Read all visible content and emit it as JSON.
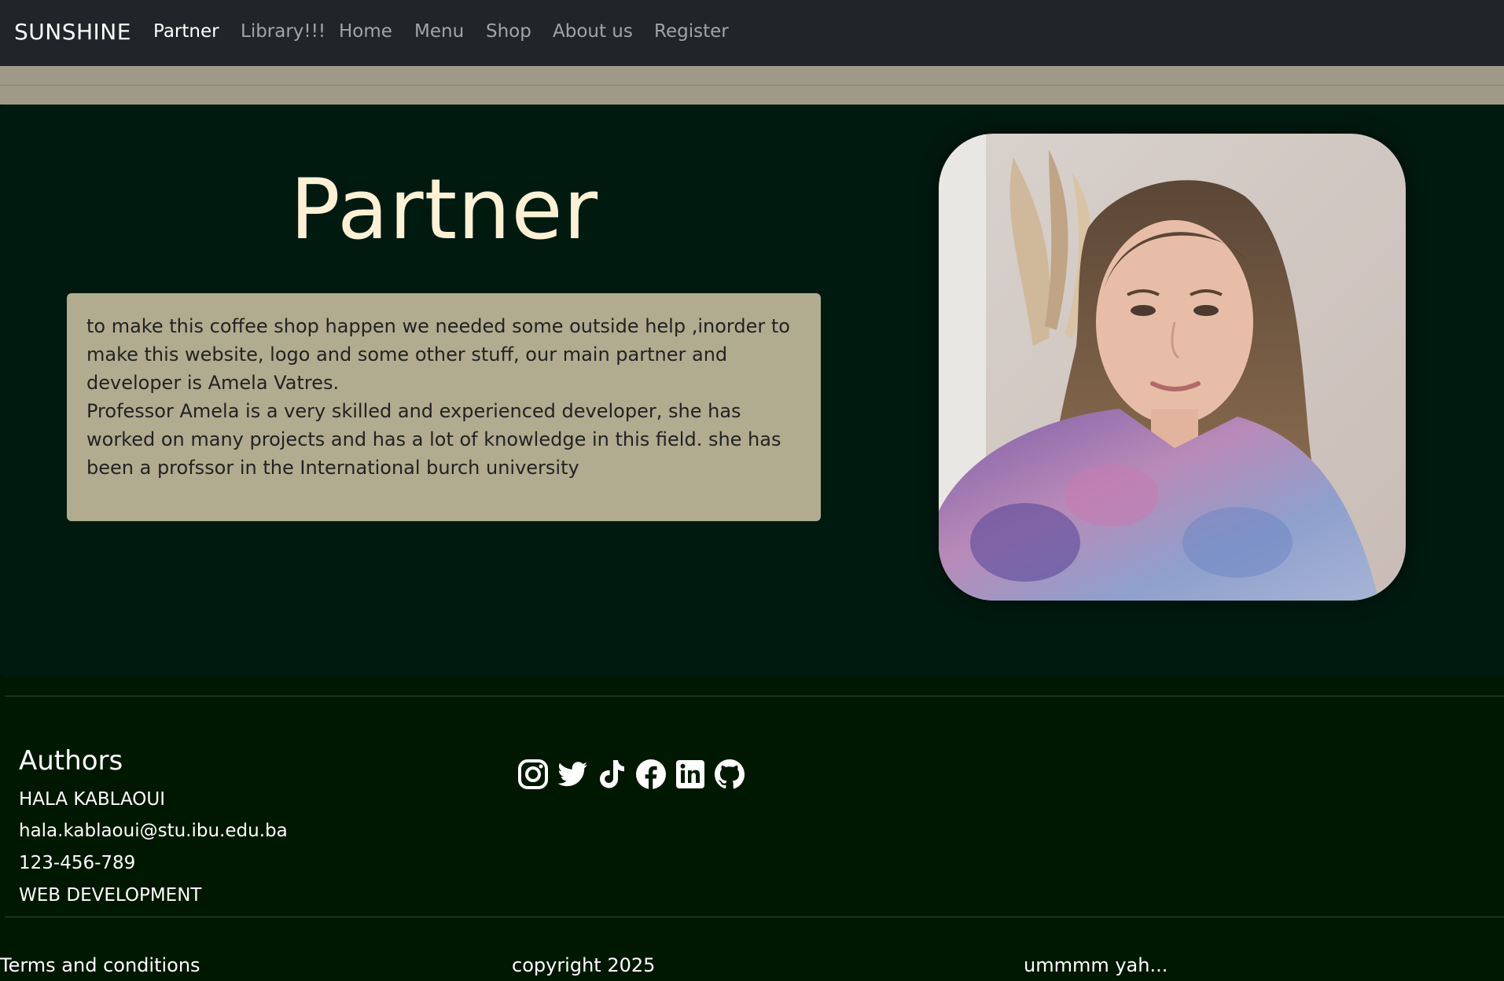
{
  "navbar": {
    "brand": "SUNSHINE",
    "items": [
      {
        "label": "Partner",
        "active": true
      },
      {
        "label": "Library!!!",
        "active": false
      },
      {
        "label": "Home",
        "active": false
      },
      {
        "label": "Menu",
        "active": false
      },
      {
        "label": "Shop",
        "active": false
      },
      {
        "label": "About us",
        "active": false
      },
      {
        "label": "Register",
        "active": false
      }
    ]
  },
  "hero": {
    "title": "Partner",
    "paragraph_1": "to make this coffee shop happen we needed some outside help ,inorder to make this website, logo and some other stuff, our main partner and developer is Amela Vatres.",
    "paragraph_2": "Professor Amela is a very skilled and experienced developer, she has worked on many projects and has a lot of knowledge in this field. she has been a profssor in the International burch university"
  },
  "footer": {
    "authors_title": "Authors",
    "author_name": "HALA KABLAOUI",
    "author_email": "hala.kablaoui@stu.ibu.edu.ba",
    "author_phone": "123-456-789",
    "author_course": "WEB DEVELOPMENT",
    "socials": [
      "instagram-icon",
      "twitter-icon",
      "tiktok-icon",
      "facebook-icon",
      "linkedin-icon",
      "github-icon"
    ],
    "terms": "Terms and conditions",
    "copyright": "copyright 2025",
    "tagline": "ummmm yah..."
  },
  "colors": {
    "navbar_bg": "#212529",
    "band": "#9f9a88",
    "hero_bg": "#001a10",
    "footer_bg": "#001800",
    "title": "#fdf0d5",
    "card": "#b1ab8f"
  }
}
